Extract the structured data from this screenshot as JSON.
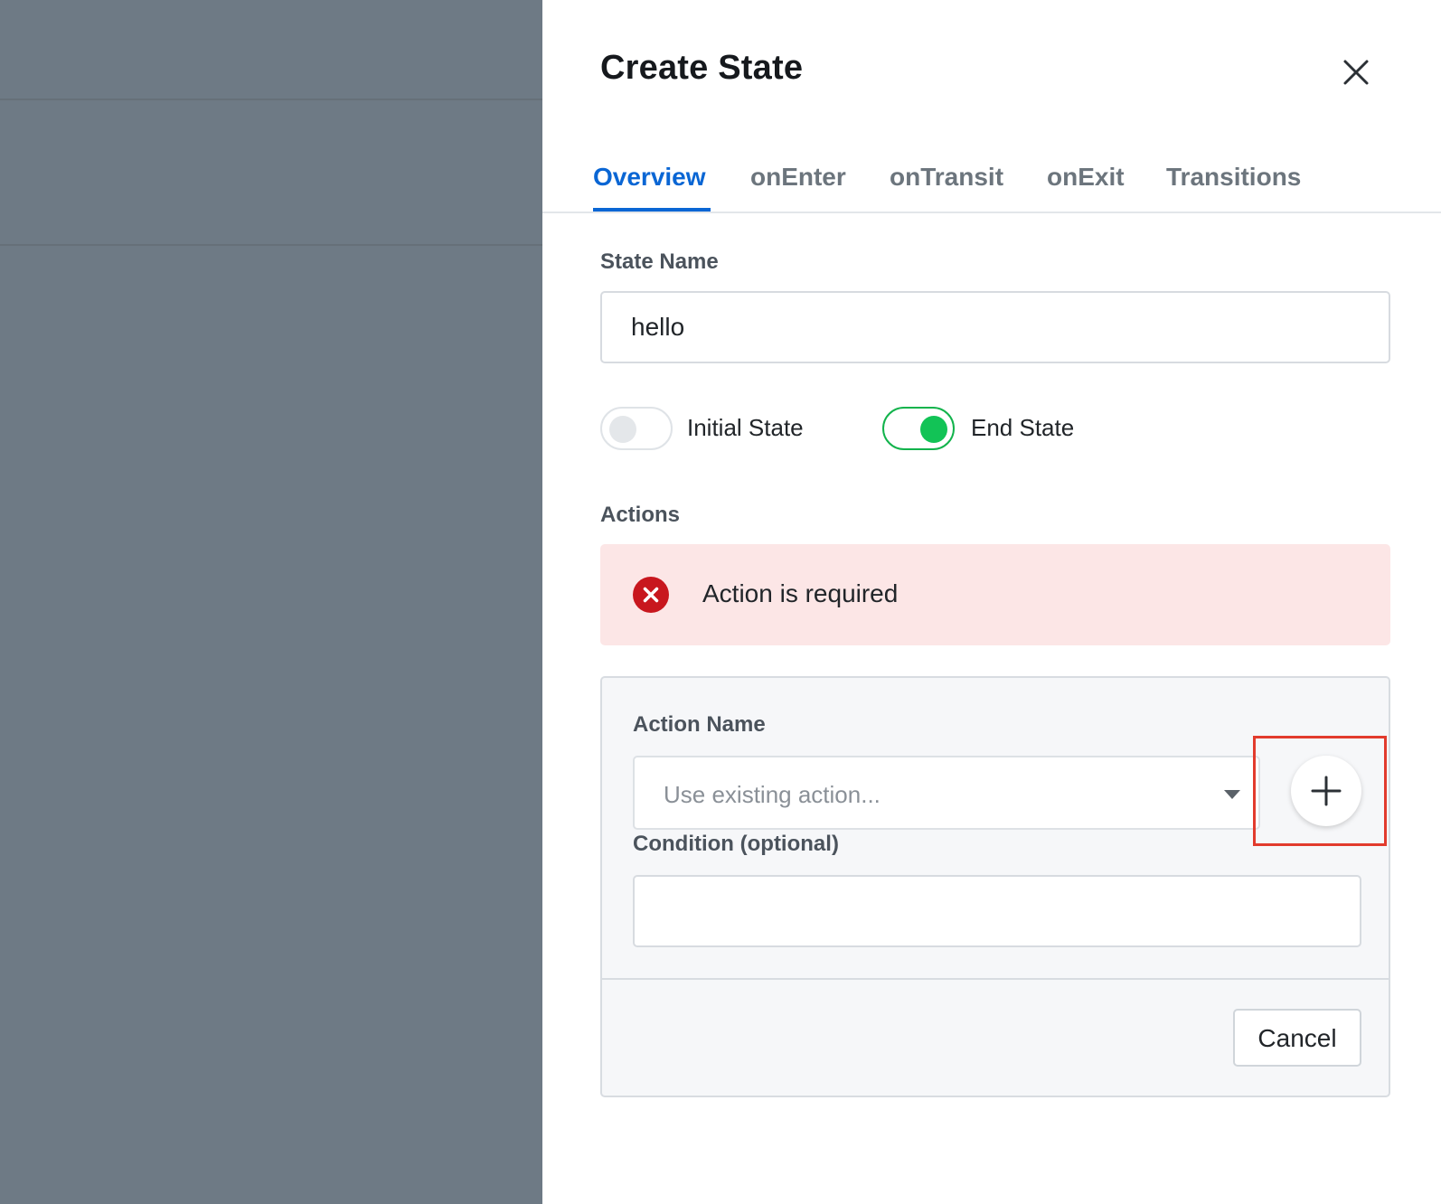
{
  "dialog": {
    "title": "Create State",
    "close_icon": "close-icon"
  },
  "tabs": [
    {
      "label": "Overview",
      "active": true
    },
    {
      "label": "onEnter",
      "active": false
    },
    {
      "label": "onTransit",
      "active": false
    },
    {
      "label": "onExit",
      "active": false
    },
    {
      "label": "Transitions",
      "active": false
    }
  ],
  "form": {
    "state_name_label": "State Name",
    "state_name_value": "hello",
    "initial_state": {
      "label": "Initial State",
      "on": false
    },
    "end_state": {
      "label": "End State",
      "on": true
    },
    "actions_label": "Actions"
  },
  "alert": {
    "icon": "error-icon",
    "message": "Action is required",
    "color": "#c8171e"
  },
  "action_panel": {
    "action_name_label": "Action Name",
    "action_select_placeholder": "Use existing action...",
    "add_icon": "plus-icon",
    "condition_label": "Condition (optional)",
    "condition_value": "",
    "cancel_label": "Cancel"
  },
  "colors": {
    "accent": "#0a66d4",
    "toggle_on": "#12c356",
    "backdrop": "#6e7a85",
    "highlight": "#e23b2d"
  }
}
